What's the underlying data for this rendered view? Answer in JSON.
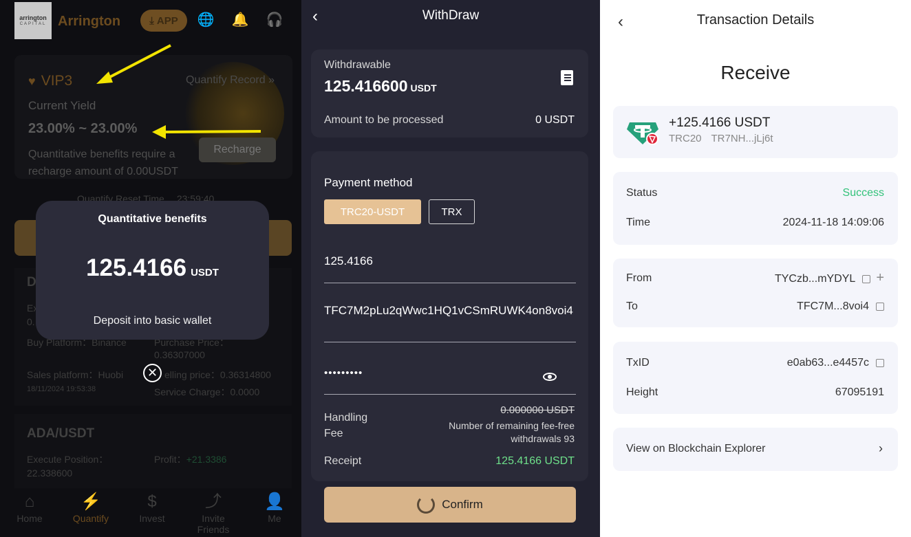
{
  "panel1": {
    "logo_line1": "arrington",
    "logo_line2": "CAPITAL",
    "brand": "Arrington",
    "app_label": "APP",
    "vip_title": "VIP3",
    "quantify_record": "Quantify Record »",
    "current_yield_label": "Current Yield",
    "current_yield_value": "23.00% ~ 23.00%",
    "benefit_text": "Quantitative benefits require a recharge amount of 0.00USDT",
    "recharge_label": "Recharge",
    "reset_label": "Quantify Reset Time",
    "reset_value": "23:59:40",
    "order1_initial": "D",
    "order1_ex": "Ex",
    "order1_zero": "0.",
    "buy_platform": "Buy Platform：Binance",
    "purchase_price_label": "Purchase Price：",
    "purchase_price": "0.36307000",
    "sales_platform": "Sales platform：Huobi",
    "selling_price": "elling price：0.36314800",
    "order_time": "18/11/2024 19:53:38",
    "service_charge": "Service Charge：0.0000",
    "order2_pair": "ADA/USDT",
    "execute_position_label": "Execute Position：",
    "execute_position": "22.338600",
    "profit_label": "Profit：",
    "profit_value": "+21.3386",
    "popup": {
      "title": "Quantitative benefits",
      "amount": "125.4166",
      "unit": "USDT",
      "subtitle": "Deposit into basic wallet"
    },
    "tabs": [
      {
        "label": "Home"
      },
      {
        "label": "Quantify"
      },
      {
        "label": "Invest"
      },
      {
        "label": "Invite Friends"
      },
      {
        "label": "Me"
      }
    ],
    "arrow_color": "#f2e400"
  },
  "panel2": {
    "title": "WithDraw",
    "withdrawable_label": "Withdrawable",
    "withdrawable_value": "125.416600",
    "withdrawable_unit": "USDT",
    "processing_label": "Amount to be processed",
    "processing_value": "0 USDT",
    "payment_method_label": "Payment method",
    "method_options": [
      "TRC20-USDT",
      "TRX"
    ],
    "amount_value": "125.4166",
    "address_value": "TFC7M2pLu2qWwc1HQ1vCSmRUWK4on8voi4",
    "password_value": "•••••••••",
    "fee_label": "Handling Fee",
    "fee_value": "0.000000 USDT",
    "fee_note": "Number of remaining fee-free withdrawals 93",
    "receipt_label": "Receipt",
    "receipt_value": "125.4166 USDT",
    "confirm_label": "Confirm",
    "accent_color": "#e6c295"
  },
  "panel3": {
    "title": "Transaction Details",
    "heading": "Receive",
    "token_amount": "+125.4166 USDT",
    "token_network": "TRC20",
    "token_address": "TR7NH...jLj6t",
    "status_label": "Status",
    "status_value": "Success",
    "time_label": "Time",
    "time_value": "2024-11-18 14:09:06",
    "from_label": "From",
    "from_value": "TYCzb...mYDYL",
    "to_label": "To",
    "to_value": "TFC7M...8voi4",
    "txid_label": "TxID",
    "txid_value": "e0ab63...e4457c",
    "height_label": "Height",
    "height_value": "67095191",
    "explorer_label": "View on Blockchain Explorer",
    "success_color": "#33c27a"
  }
}
